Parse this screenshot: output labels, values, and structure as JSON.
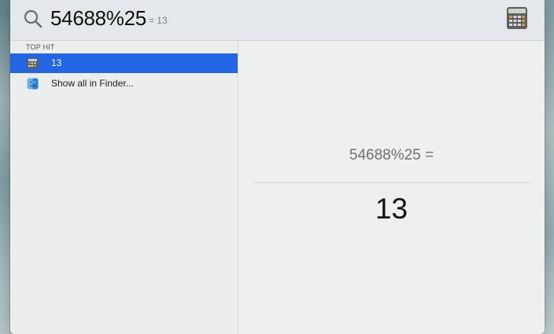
{
  "search": {
    "query": "54688%25",
    "inline_result": "= 13"
  },
  "results": {
    "section_header": "TOP HIT",
    "items": [
      {
        "label": "13",
        "icon": "calculator-icon",
        "selected": true
      },
      {
        "label": "Show all in Finder...",
        "icon": "finder-icon",
        "selected": false
      }
    ]
  },
  "preview": {
    "expression": "54688%25 =",
    "result": "13"
  },
  "colors": {
    "selection": "#2266e3",
    "panel_bg": "#eceeee"
  }
}
